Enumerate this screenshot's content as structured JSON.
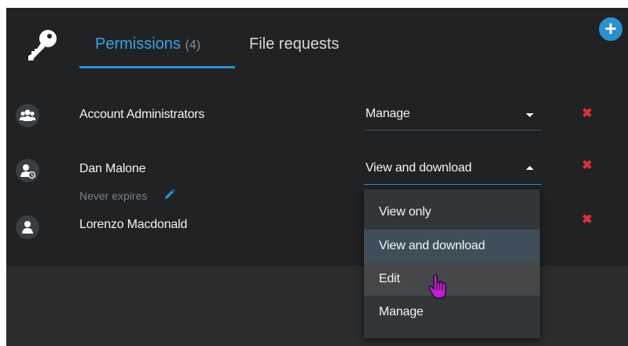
{
  "header": {
    "tabs": [
      {
        "label": "Permissions",
        "count": "(4)",
        "active": true
      },
      {
        "label": "File requests",
        "active": false
      }
    ],
    "add_button_label": "+"
  },
  "icons": {
    "header": "key-icon",
    "add": "plus-icon",
    "group": "group-icon",
    "user_expiring": "user-clock-icon",
    "user": "user-icon",
    "remove": "close-x-icon",
    "edit": "pencil-icon",
    "cursor": "hand-pointer-icon"
  },
  "permissions": [
    {
      "name": "Account Administrators",
      "role": "Manage",
      "remove_label": "✖"
    },
    {
      "name": "Dan Malone",
      "subtext": "Never expires",
      "role": "View and download",
      "remove_label": "✖"
    },
    {
      "name": "Lorenzo Macdonald",
      "remove_label": "✖"
    }
  ],
  "dropdown": {
    "options": [
      "View only",
      "View and download",
      "Edit",
      "Manage"
    ],
    "selected": "View and download",
    "hovered": "Edit"
  },
  "colors": {
    "accent": "#2a8fd2",
    "panel": "#202224",
    "remove": "#e02e3a",
    "selected_option": "#3e4f59"
  }
}
